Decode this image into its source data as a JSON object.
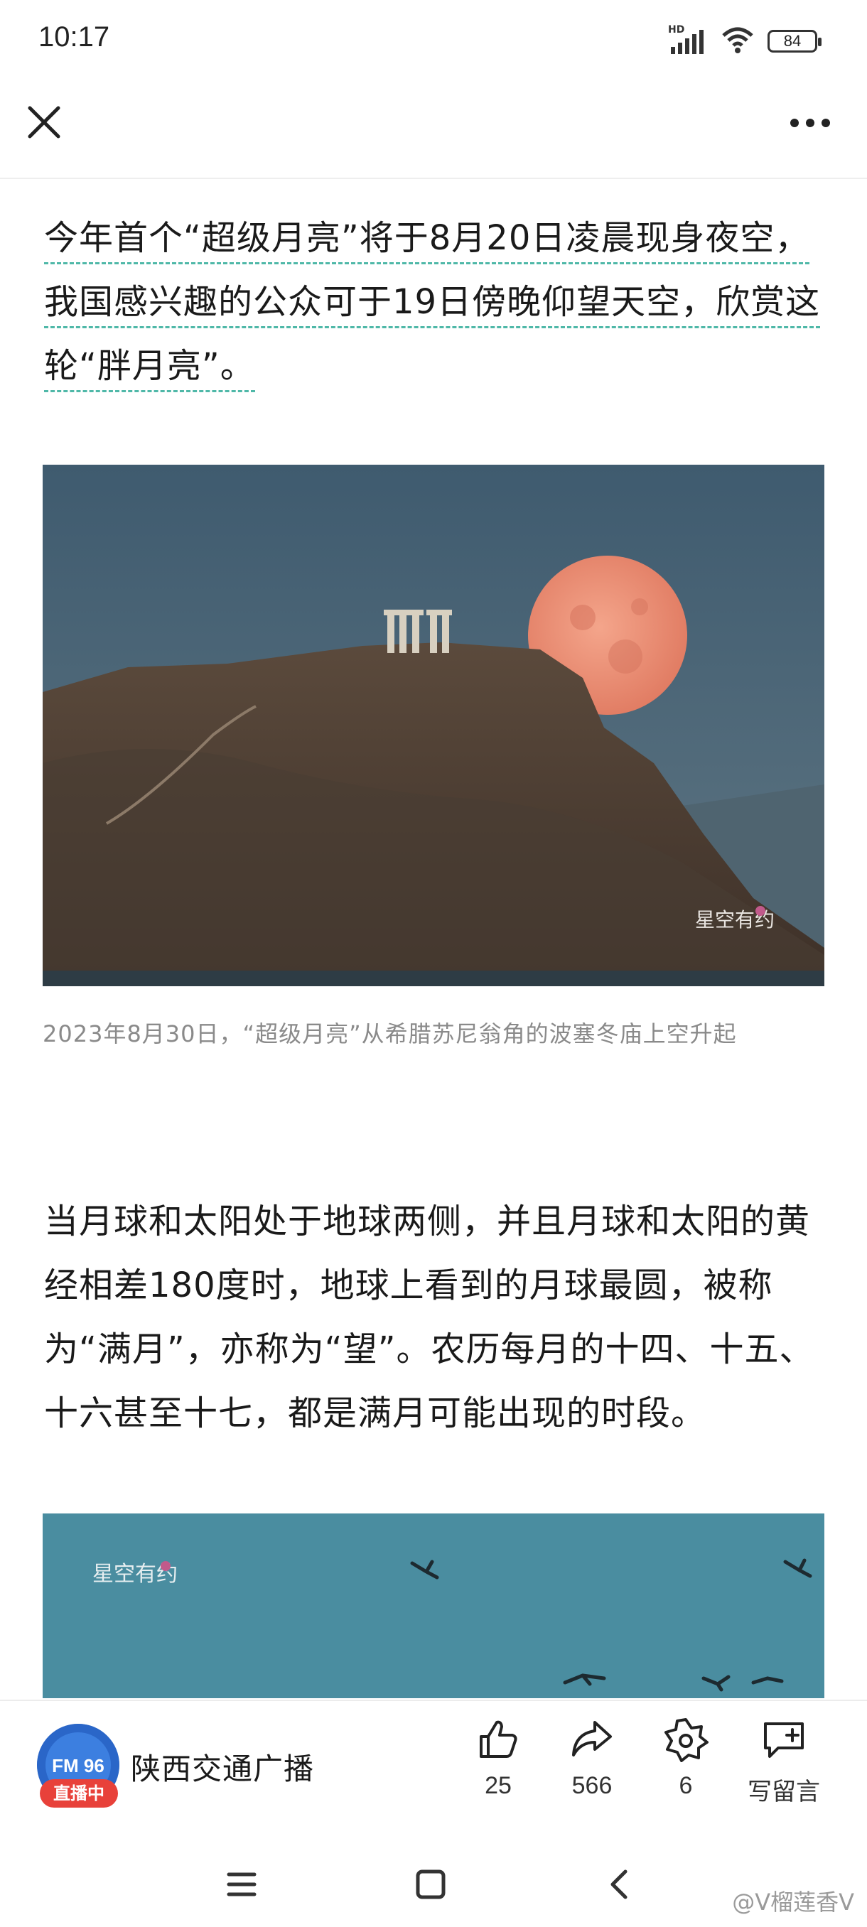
{
  "status_bar": {
    "time": "10:17",
    "network_label": "HD",
    "battery": "84"
  },
  "article": {
    "paragraph1": "今年首个“超级月亮”将于8月20日凌晨现身夜空，我国感兴趣的公众可于19日傍晚仰望天空，欣赏这轮“胖月亮”。",
    "photo1_watermark": "星空有约",
    "caption1": "2023年8月30日，“超级月亮”从希腊苏尼翁角的波塞冬庙上空升起",
    "paragraph2": "当月球和太阳处于地球两侧，并且月球和太阳的黄经相差180度时，地球上看到的月球最圆，被称为“满月”，亦称为“望”。农历每月的十四、十五、十六甚至十七，都是满月可能出现的时段。",
    "photo2_watermark": "星空有约"
  },
  "action_bar": {
    "account_name": "陕西交通广播",
    "live_badge": "直播中",
    "avatar_text": "FM 96",
    "like_count": "25",
    "share_count": "566",
    "favorite_count": "6",
    "comment_label": "写留言"
  },
  "watermark": "@V榴莲香V",
  "colors": {
    "accent_underline": "#4fb8a8",
    "live_badge": "#e8413a",
    "avatar": "#2a66c8"
  },
  "icons": [
    "close-icon",
    "more-icon",
    "like-icon",
    "share-icon",
    "favorite-icon",
    "comment-icon",
    "menu-icon",
    "home-icon",
    "back-icon"
  ]
}
